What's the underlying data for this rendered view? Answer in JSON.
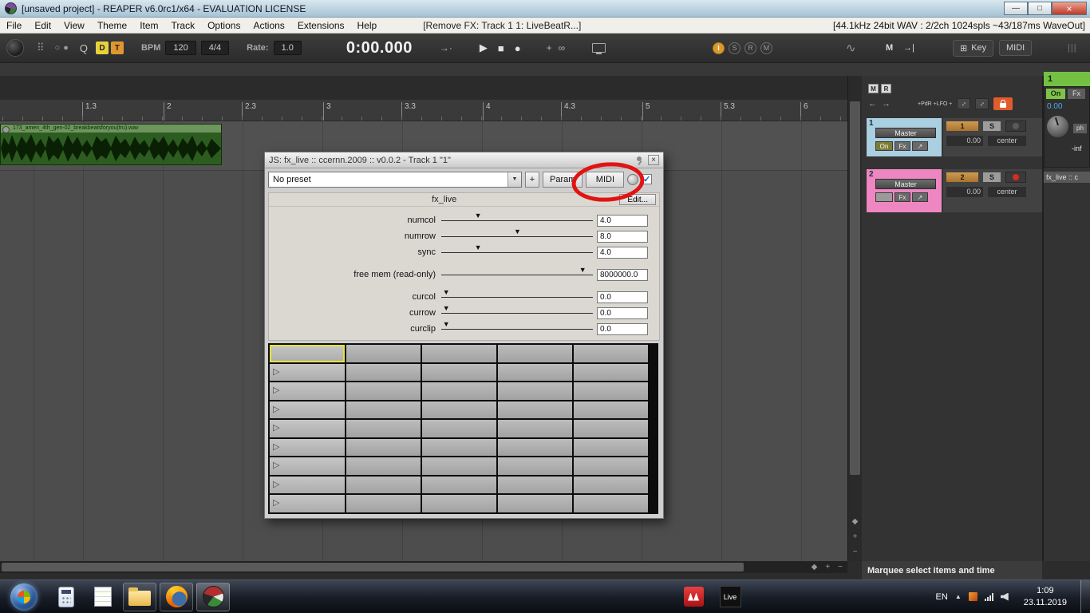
{
  "titlebar": {
    "title": "[unsaved project] - REAPER v6.0rc1/x64 - EVALUATION LICENSE"
  },
  "menubar": {
    "items": [
      "File",
      "Edit",
      "View",
      "Theme",
      "Item",
      "Track",
      "Options",
      "Actions",
      "Extensions",
      "Help"
    ],
    "last_action": "[Remove FX: Track 1 1: LiveBeatR...]",
    "audio_status": "[44.1kHz 24bit WAV : 2/2ch 1024spls ~43/187ms WaveOut]"
  },
  "toolbar": {
    "q": "Q",
    "d": "D",
    "t": "T",
    "bpm_label": "BPM",
    "bpm": "120",
    "timesig": "4/4",
    "rate_label": "Rate:",
    "rate": "1.0",
    "time": "0:00.000",
    "status_circles": [
      "i",
      "S",
      "R",
      "M"
    ],
    "m_label": "M",
    "key_label": "Key",
    "midi_label": "MIDI"
  },
  "ruler": {
    "marks": [
      "1.3",
      "2",
      "2.3",
      "3",
      "3.3",
      "4",
      "4.3",
      "5",
      "5.3",
      "6"
    ]
  },
  "arrange": {
    "item_name": "173_amen_4th_gen-02_breakbeatsforyou(tru).wav"
  },
  "fx_window": {
    "title": "JS: fx_live :: ccernn.2009 :: v0.0.2 - Track 1 \"1\"",
    "preset": "No preset",
    "plus": "+",
    "param": "Param",
    "midi": "MIDI",
    "ui_check": "✓",
    "plugin_name": "fx_live",
    "edit": "Edit...",
    "sliders": [
      {
        "label": "numcol",
        "value": "4.0",
        "pos": 0.24
      },
      {
        "label": "numrow",
        "value": "8.0",
        "pos": 0.5
      },
      {
        "label": "sync",
        "value": "4.0",
        "pos": 0.24
      },
      {
        "label": "free mem (read-only)",
        "value": "8000000.0",
        "pos": 0.93
      },
      {
        "label": "curcol",
        "value": "0.0",
        "pos": 0.03
      },
      {
        "label": "currow",
        "value": "0.0",
        "pos": 0.03
      },
      {
        "label": "curclip",
        "value": "0.0",
        "pos": 0.03
      }
    ],
    "grid": {
      "rows": 9,
      "cols": 5,
      "selected_cell": [
        0,
        0
      ]
    }
  },
  "right_panel": {
    "mr": [
      "M",
      "R"
    ],
    "env_label": "+PdR +LFO +",
    "tracks": [
      {
        "num": "1",
        "name": "Master",
        "on": "On",
        "fx": "Fx",
        "route": "↗",
        "badge": "1",
        "solo": "S",
        "vol": "0.00",
        "pan": "center",
        "color": "#a9cfe0",
        "rec_color": "#5a5a5a"
      },
      {
        "num": "2",
        "name": "Master",
        "on": "",
        "fx": "Fx",
        "route": "↗",
        "badge": "2",
        "solo": "S",
        "vol": "0.00",
        "pan": "center",
        "color": "#ee86c2",
        "rec_color": "#d22d22"
      }
    ],
    "status": "Marquee select items and time"
  },
  "mixer": {
    "tab": "1",
    "on": "On",
    "fx": "Fx",
    "vol": "0.00",
    "ph": "ph",
    "inf": "-inf",
    "fx_label": "fx_live :: c"
  },
  "taskbar": {
    "live": "Live",
    "lang": "EN",
    "time": "1:09",
    "date": "23.11.2019"
  },
  "icons": {
    "minimize": "—",
    "maximize": "□",
    "close": "×",
    "grid_dots": "⠿",
    "circle_a": "○",
    "circle_b": "●",
    "seek": "→·",
    "play": "▶",
    "stop": "■",
    "record": "●",
    "plus": "+",
    "link": "∞",
    "wave": "∿",
    "m_end": "→|",
    "grid": "⊞",
    "bars": "|||",
    "dropdown": "▼",
    "slider_thumb": "▼",
    "clip_play": "▷",
    "left": "←",
    "right": "→",
    "diag": "↕",
    "diamond": "◆",
    "minus": "−",
    "up": "▲"
  },
  "colors": {
    "annotation": "#e01412",
    "mixer_green": "#74c043"
  }
}
